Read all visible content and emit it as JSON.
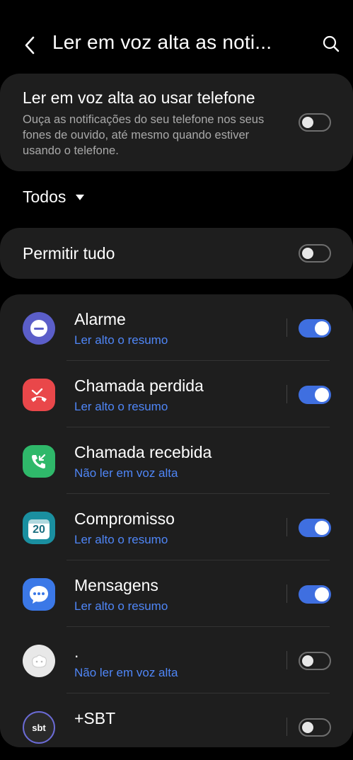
{
  "header": {
    "title": "Ler em voz alta as noti..."
  },
  "phone_card": {
    "title": "Ler em voz alta ao usar telefone",
    "description": "Ouça as notificações do seu telefone nos seus fones de ouvido, até mesmo quando estiver usando o telefone.",
    "enabled": false
  },
  "filter": {
    "label": "Todos"
  },
  "allow_all": {
    "label": "Permitir tudo",
    "enabled": false
  },
  "apps": [
    {
      "name": "Alarme",
      "status": "Ler alto o resumo",
      "enabled": true,
      "icon": "alarm-icon"
    },
    {
      "name": "Chamada perdida",
      "status": "Ler alto o resumo",
      "enabled": true,
      "icon": "missed-call-icon"
    },
    {
      "name": "Chamada recebida",
      "status": "Não ler em voz alta",
      "enabled": null,
      "icon": "incoming-call-icon"
    },
    {
      "name": "Compromisso",
      "status": "Ler alto o resumo",
      "enabled": true,
      "icon": "calendar-icon",
      "icon_text": "20"
    },
    {
      "name": "Mensagens",
      "status": "Ler alto o resumo",
      "enabled": true,
      "icon": "messages-icon"
    },
    {
      "name": ".",
      "status": "Não ler em voz alta",
      "enabled": false,
      "icon": "generic-app-icon"
    },
    {
      "name": "+SBT",
      "status": "",
      "enabled": false,
      "icon": "sbt-icon",
      "icon_text": "sbt"
    }
  ],
  "colors": {
    "accent": "#3f6fe0",
    "link": "#4f86f7",
    "card": "#1e1e1e"
  }
}
